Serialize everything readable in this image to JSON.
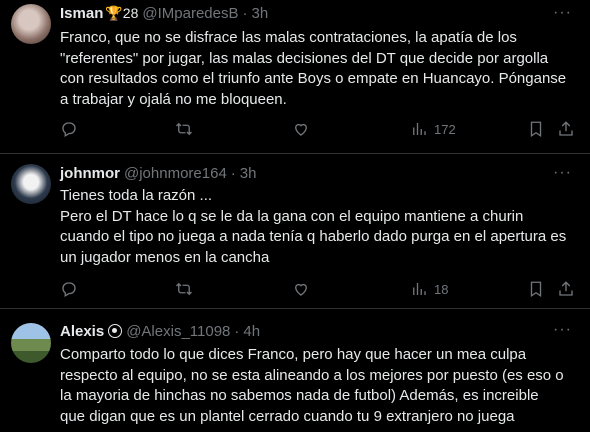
{
  "tweets": [
    {
      "name": "Isman",
      "badge": "🏆28",
      "handle": "@IMparedesB",
      "dot": "·",
      "time": "3h",
      "lines": [
        "Franco, que no se disfrace las malas contrataciones, la apatía de los",
        "\"referentes\" por jugar, las malas decisiones del DT que decide por argolla",
        "con resultados como el triunfo ante Boys o empate en Huancayo. Pónganse",
        "a trabajar y ojalá no me bloqueen."
      ],
      "views": "172"
    },
    {
      "name": "johnmor",
      "handle": "@johnmore164",
      "dot": "·",
      "time": "3h",
      "lines": [
        "Tienes toda la razón ...",
        "Pero el DT hace lo q se le da la gana con el equipo mantiene a churin",
        "cuando el tipo no juega a nada tenía q haberlo dado purga en el apertura es",
        "un jugador menos en la cancha"
      ],
      "views": "18"
    },
    {
      "name": "Alexis",
      "handle": "@Alexis_11098",
      "dot": "·",
      "time": "4h",
      "lines": [
        "Comparto todo lo que dices Franco, pero hay que hacer un mea culpa",
        "respecto al equipo, no se esta alineando a los mejores por puesto (es eso o",
        "la mayoria de hinchas no sabemos nada de futbol) Además, es increible",
        "que digan que es un plantel cerrado cuando tu 9 extranjero no juega"
      ]
    }
  ],
  "icons": {
    "more": "more-dots-icon",
    "reply": "reply-icon",
    "retweet": "retweet-icon",
    "like": "heart-icon",
    "views": "views-icon",
    "bookmark": "bookmark-icon",
    "share": "share-icon"
  }
}
